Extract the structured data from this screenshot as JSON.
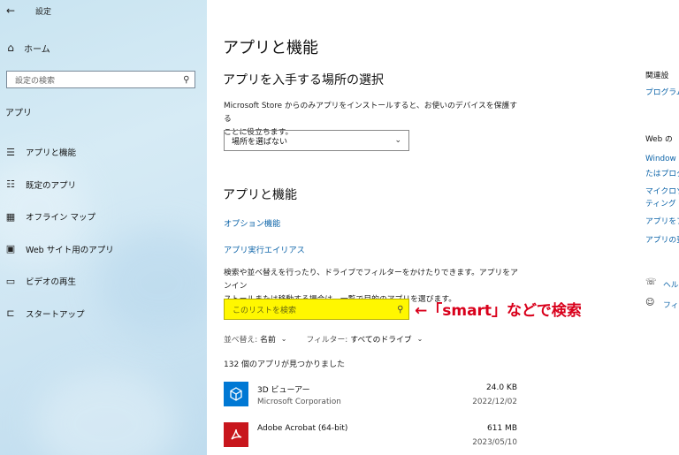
{
  "sidebar": {
    "title": "設定",
    "back_icon": "←",
    "home": {
      "icon": "⌂",
      "label": "ホーム"
    },
    "search": {
      "placeholder": "設定の検索",
      "icon": "⚲"
    },
    "section": "アプリ",
    "items": [
      {
        "icon": "☰",
        "label": "アプリと機能"
      },
      {
        "icon": "☷",
        "label": "既定のアプリ"
      },
      {
        "icon": "▦",
        "label": "オフライン マップ"
      },
      {
        "icon": "▣",
        "label": "Web サイト用のアプリ"
      },
      {
        "icon": "▭",
        "label": "ビデオの再生"
      },
      {
        "icon": "⊏",
        "label": "スタートアップ"
      }
    ]
  },
  "main": {
    "title": "アプリと機能",
    "source_heading": "アプリを入手する場所の選択",
    "source_desc_1": "Microsoft Store からのみアプリをインストールすると、お使いのデバイスを保護する",
    "source_desc_2": "ことに役立ちます。",
    "source_dropdown": "場所を選ばない",
    "apps_heading": "アプリと機能",
    "optional_features_link": "オプション機能",
    "app_alias_link": "アプリ実行エイリアス",
    "list_desc_1": "検索や並べ替えを行ったり、ドライブでフィルターをかけたりできます。アプリをアンイン",
    "list_desc_2": "ストールまたは移動する場合は、一覧で目的のアプリを選びます。",
    "list_search_placeholder": "このリストを検索",
    "annotation": "←「smart」などで検索",
    "sort_label": "並べ替え:",
    "sort_value": "名前",
    "filter_label": "フィルター:",
    "filter_value": "すべてのドライブ",
    "count_text": "132 個のアプリが見つかりました",
    "apps": [
      {
        "name": "3D ビューアー",
        "publisher": "Microsoft Corporation",
        "size": "24.0 KB",
        "date": "2022/12/02",
        "icon": "cube-icon",
        "color": "#0078d4"
      },
      {
        "name": "Adobe Acrobat (64-bit)",
        "publisher": "",
        "size": "611 MB",
        "date": "2023/05/10",
        "icon": "acrobat-icon",
        "color": "#c8161d"
      }
    ]
  },
  "right": {
    "related_heading": "関連設",
    "related_link": "プログラム",
    "web_heading": "Web の",
    "web_links": [
      "Window",
      "たはプログ",
      "マイクロソ",
      "ティング",
      "アプリをア",
      "アプリの更"
    ],
    "help_link": "ヘル",
    "feedback_link": "フィ"
  }
}
